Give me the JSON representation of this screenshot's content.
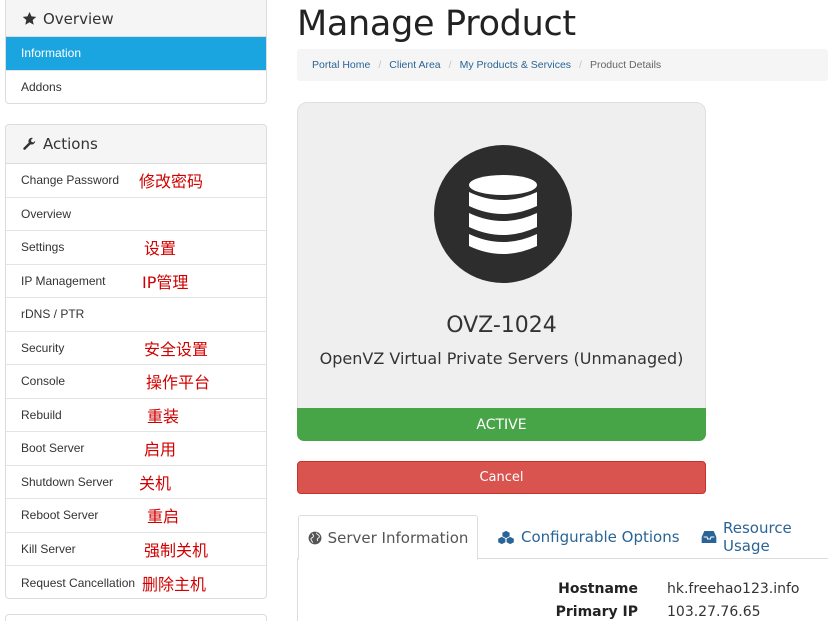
{
  "sidebar": {
    "overview": {
      "title": "Overview",
      "icon": "star-icon",
      "items": [
        {
          "label": "Information",
          "active": true
        },
        {
          "label": "Addons",
          "active": false
        }
      ]
    },
    "actions": {
      "title": "Actions",
      "icon": "wrench-icon",
      "items": [
        {
          "label": "Change Password",
          "note": "修改密码"
        },
        {
          "label": "Overview",
          "note": ""
        },
        {
          "label": "Settings",
          "note": "设置"
        },
        {
          "label": "IP Management",
          "note": "IP管理"
        },
        {
          "label": "rDNS / PTR",
          "note": ""
        },
        {
          "label": "Security",
          "note": "安全设置"
        },
        {
          "label": "Console",
          "note": "操作平台"
        },
        {
          "label": "Rebuild",
          "note": "重装"
        },
        {
          "label": "Boot Server",
          "note": "启用"
        },
        {
          "label": "Shutdown Server",
          "note": "关机"
        },
        {
          "label": "Reboot Server",
          "note": "重启"
        },
        {
          "label": "Kill Server",
          "note": "强制关机"
        },
        {
          "label": "Request Cancellation",
          "note": "删除主机"
        }
      ]
    }
  },
  "main": {
    "title": "Manage Product",
    "breadcrumb": [
      "Portal Home",
      "Client Area",
      "My Products & Services",
      "Product Details"
    ],
    "product": {
      "icon": "database-icon",
      "name": "OVZ-1024",
      "description": "OpenVZ Virtual Private Servers (Unmanaged)",
      "status": "ACTIVE"
    },
    "cancel_label": "Cancel",
    "tabs": [
      {
        "label": "Server Information",
        "icon": "globe-icon",
        "active": true
      },
      {
        "label": "Configurable Options",
        "icon": "cubes-icon",
        "active": false
      },
      {
        "label": "Resource Usage",
        "icon": "inbox-icon",
        "active": false
      }
    ],
    "server_info": [
      {
        "key": "Hostname",
        "value": "hk.freehao123.info"
      },
      {
        "key": "Primary IP",
        "value": "103.27.76.65"
      }
    ]
  },
  "colors": {
    "accent": "#1ba5e0",
    "status_active": "#47a447",
    "danger": "#d9534f",
    "note_red": "#d10000",
    "link": "#2a6496"
  }
}
